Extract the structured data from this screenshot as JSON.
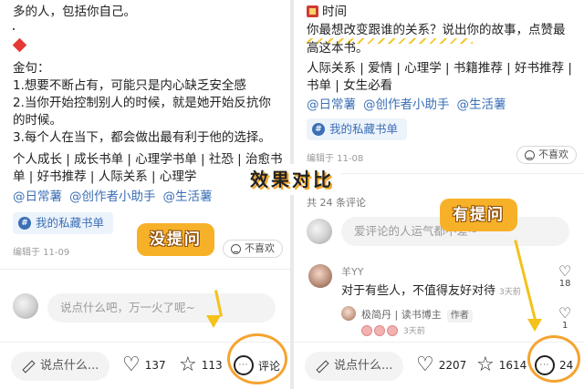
{
  "left": {
    "top_line": "多的人，包括你自己。",
    "dot": "·",
    "quote_label": "金句：",
    "quotes": [
      "1.想要不断占有，可能只是内心缺乏安全感",
      "2.当你开始控制别人的时候，就是她开始反抗你",
      "的时候。",
      "3.每个人在当下，都会做出最有利于他的选择。"
    ],
    "tags_line1": "个人成长 | 成长书单 | 心理学书单 | 社恐 | 治愈书",
    "tags_line2": "单 | 好书推荐 | 人际关系 | 心理学",
    "mentions": [
      "@日常薯",
      "@创作者小助手",
      "@生活薯"
    ],
    "fav_chip": "我的私藏书单",
    "edited": "编辑于 11-09",
    "dislike": "不喜欢",
    "input_placeholder": "说点什么吧，万一火了呢~",
    "say_label": "说点什么...",
    "likes": "137",
    "stars": "113",
    "comment_label": "评论",
    "overlay_label": "没提问"
  },
  "center_label": "效果对比",
  "right": {
    "time_title": "时间",
    "question_line1": "你最想改变跟谁的关系？说出你的故事，点赞最",
    "question_line2": "高这本书。",
    "tags_line1": "人际关系 | 爱情 | 心理学 | 书籍推荐 | 好书推荐 |",
    "tags_line2": "书单 | 女生必看",
    "mentions": [
      "@日常薯",
      "@创作者小助手",
      "@生活薯"
    ],
    "fav_chip": "我的私藏书单",
    "edited": "编辑于 11-08",
    "dislike": "不喜欢",
    "comment_count": "共 24 条评论",
    "input_placeholder": "爱评论的人运气都不差~",
    "comment1_user": "羊YY",
    "comment1_text": "对于有些人，不值得友好对待",
    "comment1_time": "3天前",
    "comment1_likes": "18",
    "reply_user": "极简丹 | 读书博主",
    "reply_badge": "作者",
    "reply_time": "3天前",
    "reply_likes": "1",
    "say_label": "说点什么...",
    "likes": "2207",
    "stars": "1614",
    "comments": "24",
    "overlay_label": "有提问"
  },
  "colors": {
    "accent": "#f6a330",
    "link": "#3b6fb6",
    "label_bg": "#f7b129"
  }
}
